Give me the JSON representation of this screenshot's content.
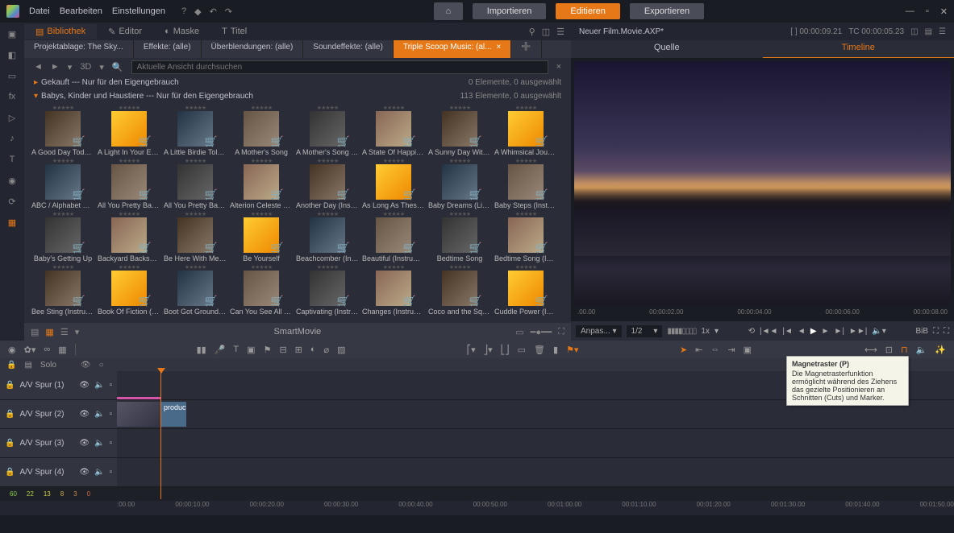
{
  "menu": {
    "file": "Datei",
    "edit": "Bearbeiten",
    "settings": "Einstellungen"
  },
  "topButtons": {
    "import": "Importieren",
    "edit": "Editieren",
    "export": "Exportieren"
  },
  "libTabs": {
    "library": "Bibliothek",
    "editor": "Editor",
    "mask": "Maske",
    "title": "Titel"
  },
  "filters": {
    "project": "Projektablage: The Sky...",
    "effects": "Effekte: (alle)",
    "transitions": "Überblendungen: (alle)",
    "soundfx": "Soundeffekte: (alle)",
    "music": "Triple Scoop Music: (al..."
  },
  "search": {
    "placeholder": "Aktuelle Ansicht durchsuchen",
    "threeD": "3D"
  },
  "categories": {
    "purchased": {
      "label": "Gekauft --- Nur für den Eigengebrauch",
      "info": "0 Elemente, 0 ausgewählt"
    },
    "babies": {
      "label": "Babys, Kinder und Haustiere --- Nur für den Eigengebrauch",
      "info": "113 Elemente, 0 ausgewählt"
    }
  },
  "items": [
    {
      "l": "A Good Day Today (I..."
    },
    {
      "l": "A Light In Your Eyes ..."
    },
    {
      "l": "A Little Birdie Told ..."
    },
    {
      "l": "A Mother's Song"
    },
    {
      "l": "A Mother's Song (Ins..."
    },
    {
      "l": "A State Of Happiness..."
    },
    {
      "l": "A Sunny Day With Y..."
    },
    {
      "l": "A Whimsical Journey..."
    },
    {
      "l": "ABC / Alphabet Son..."
    },
    {
      "l": "All You Pretty Babies"
    },
    {
      "l": "All You Pretty Babies..."
    },
    {
      "l": "Alterion Celeste (Inst..."
    },
    {
      "l": "Another Day (Instru..."
    },
    {
      "l": "As Long As These M..."
    },
    {
      "l": "Baby Dreams (Light ..."
    },
    {
      "l": "Baby Steps (Instrum..."
    },
    {
      "l": "Baby's Getting Up"
    },
    {
      "l": "Backyard Backsplash..."
    },
    {
      "l": "Be Here With Me (In..."
    },
    {
      "l": "Be Yourself"
    },
    {
      "l": "Beachcomber (Instru..."
    },
    {
      "l": "Beautiful (Instrumen..."
    },
    {
      "l": "Bedtime Song"
    },
    {
      "l": "Bedtime Song (Instr..."
    },
    {
      "l": "Bee Sting (Instrumen..."
    },
    {
      "l": "Book Of Fiction (Inst..."
    },
    {
      "l": "Boot Got Grounded ..."
    },
    {
      "l": "Can You See All The ..."
    },
    {
      "l": "Captivating (Instrum..."
    },
    {
      "l": "Changes (Instrument..."
    },
    {
      "l": "Coco and the Squirr..."
    },
    {
      "l": "Cuddle Power (Instr..."
    }
  ],
  "libFooter": {
    "smartMovie": "SmartMovie"
  },
  "preview": {
    "title": "Neuer Film.Movie.AXP*",
    "tcLeft": "[ ]  00:00:09.21",
    "tcRight": "TC  00:00:05.23",
    "tabSource": "Quelle",
    "tabTimeline": "Timeline",
    "ruler": [
      ".00.00",
      "00:00:02.00",
      "00:00:04.00",
      "00:00:06.00",
      "00:00:08.00"
    ],
    "fit": "Anpas...",
    "zoom": "1/2",
    "speed": "1x",
    "bib": "BiB"
  },
  "tracks": {
    "solo": "Solo",
    "list": [
      {
        "name": "A/V Spur (1)"
      },
      {
        "name": "A/V Spur (2)"
      },
      {
        "name": "A/V Spur (3)"
      },
      {
        "name": "A/V Spur (4)"
      }
    ],
    "clipText": "producti..."
  },
  "timelineRuler": [
    ":00.00",
    "00:00:10.00",
    "00:00:20.00",
    "00:00:30.00",
    "00:00:40.00",
    "00:00:50.00",
    "00:01:00.00",
    "00:01:10.00",
    "00:01:20.00",
    "00:01:30.00",
    "00:01:40.00",
    "00:01:50.00"
  ],
  "scale": [
    "60",
    "22",
    "13",
    "8",
    "3",
    "0"
  ],
  "tooltip": {
    "title": "Magnetraster (P)",
    "body": "Die Magnetrasterfunktion ermöglicht während des Ziehens das gezielte Positionieren an Schnitten (Cuts) und Marker."
  }
}
